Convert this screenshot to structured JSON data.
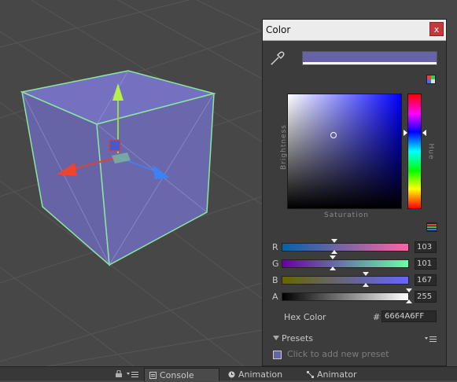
{
  "window": {
    "title": "Color",
    "close_label": "x"
  },
  "color": {
    "hex": "6664A6FF",
    "preview": "#6664a6"
  },
  "labels": {
    "brightness": "Brightness",
    "hue": "Hue",
    "saturation": "Saturation"
  },
  "channels": [
    {
      "name": "R",
      "value": "103"
    },
    {
      "name": "G",
      "value": "101"
    },
    {
      "name": "B",
      "value": "167"
    },
    {
      "name": "A",
      "value": "255"
    }
  ],
  "hex_row": {
    "label": "Hex Color",
    "hash": "#",
    "value": "6664A6FF"
  },
  "presets": {
    "label": "Presets",
    "hint": "Click to add new preset"
  },
  "bottom_tabs": [
    {
      "label": "Console",
      "icon": "console-icon",
      "active": true
    },
    {
      "label": "Animation",
      "icon": "clock-icon",
      "active": false
    },
    {
      "label": "Animator",
      "icon": "animator-icon",
      "active": false
    }
  ],
  "icons": {
    "eyedropper": "eyedropper-icon",
    "color_mode": "color-mode-icon",
    "slider_mode": "slider-mode-icon",
    "presets_menu": "menu-icon",
    "lock": "lock-icon"
  }
}
